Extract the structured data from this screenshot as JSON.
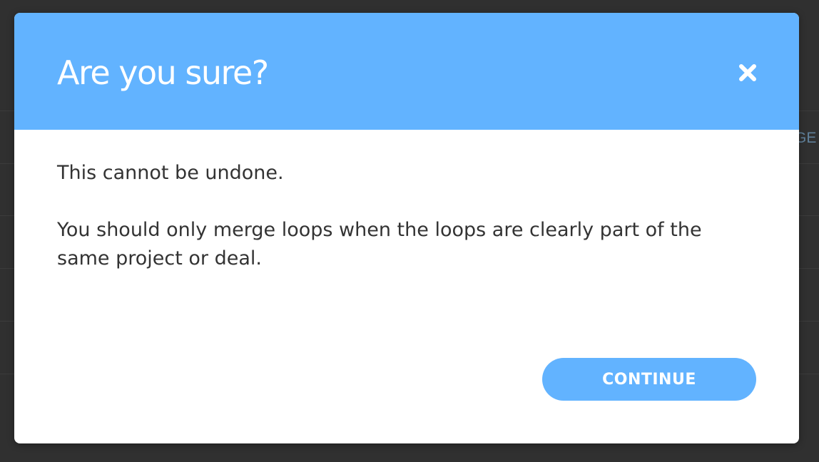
{
  "colors": {
    "accent": "#62b3ff",
    "overlay": "#303030",
    "body_text": "#333333",
    "title_text": "#ffffff"
  },
  "background": {
    "edge_text": "GE"
  },
  "modal": {
    "title": "Are you sure?",
    "close_icon": "close-icon",
    "body": {
      "line1": "This cannot be undone.",
      "line2": "You should only merge loops when the loops are clearly part of the same project or deal."
    },
    "continue_label": "CONTINUE"
  }
}
